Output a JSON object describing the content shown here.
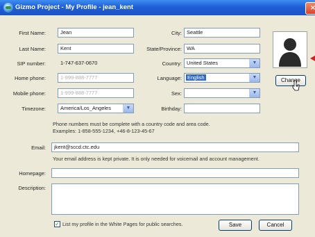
{
  "window": {
    "title": "Gizmo Project - My Profile - jean_kent",
    "close_glyph": "×"
  },
  "form": {
    "first_name": {
      "label": "First Name:",
      "value": "Jean"
    },
    "last_name": {
      "label": "Last Name:",
      "value": "Kent"
    },
    "sip_number": {
      "label": "SIP number:",
      "value": "1-747-637-0670"
    },
    "home_phone": {
      "label": "Home phone:",
      "placeholder": "1-999-888-7777"
    },
    "mobile_phone": {
      "label": "Mobile phone:",
      "placeholder": "1-999-888-7777"
    },
    "timezone": {
      "label": "Timezone:",
      "value": "America/Los_Angeles"
    },
    "city": {
      "label": "City:",
      "value": "Seattle"
    },
    "state": {
      "label": "State/Province:",
      "value": "WA"
    },
    "country": {
      "label": "Country:",
      "value": "United States"
    },
    "language": {
      "label": "Language:",
      "value": "English"
    },
    "sex": {
      "label": "Sex:",
      "value": ""
    },
    "birthday": {
      "label": "Birthday:",
      "value": ""
    },
    "phone_note_line1": "Phone numbers must be complete with a country code and area code.",
    "phone_note_line2": "Examples: 1-858-555-1234, +46-8-123-45-67",
    "email": {
      "label": "Email:",
      "value": "jkent@sccd.ctc.edu"
    },
    "email_note": "Your email address is kept private. It is only needed for voicemail and account management.",
    "homepage": {
      "label": "Homepage:",
      "value": ""
    },
    "description": {
      "label": "Description:",
      "value": ""
    },
    "white_pages": {
      "label": "List my profile in the White Pages for public searches.",
      "checked": true,
      "check_glyph": "✓"
    }
  },
  "buttons": {
    "change": "Change",
    "save": "Save",
    "cancel": "Cancel"
  },
  "icons": {
    "dropdown": "chevron-down-icon",
    "avatar": "person-silhouette-icon",
    "cursor": "pointer-cursor-icon",
    "dropdown_glyph": "▼"
  }
}
